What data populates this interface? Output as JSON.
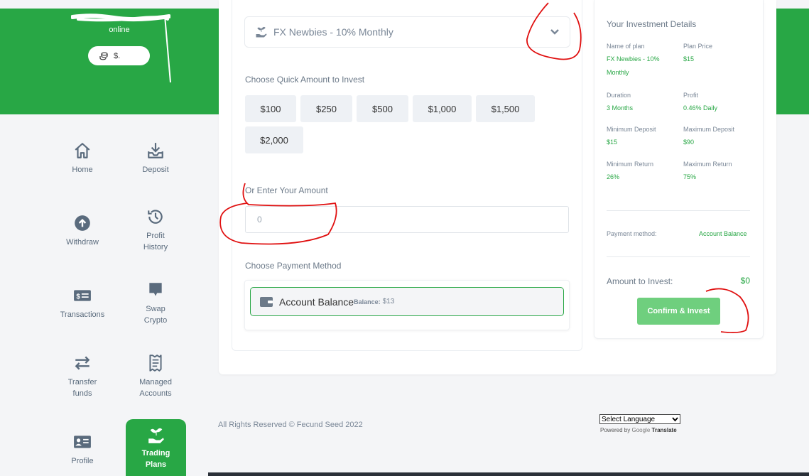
{
  "colors": {
    "brand_green": "#28a745",
    "confirm_green": "#6fcf7e",
    "annotation_red": "#e01010"
  },
  "sidebar": {
    "status": "online",
    "balance": "$.",
    "items": [
      {
        "label": "Home",
        "icon": "home-icon"
      },
      {
        "label": "Deposit",
        "icon": "download-icon"
      },
      {
        "label": "Withdraw",
        "icon": "arrow-up-circle-icon"
      },
      {
        "label": "Profit History",
        "icon": "history-icon"
      },
      {
        "label": "Transactions",
        "icon": "money-icon"
      },
      {
        "label": "Swap Crypto",
        "icon": "chat-icon"
      },
      {
        "label": "Transfer funds",
        "icon": "transfer-icon"
      },
      {
        "label": "Managed Accounts",
        "icon": "receipt-icon"
      },
      {
        "label": "Profile",
        "icon": "id-card-icon"
      },
      {
        "label": "Trading Plans",
        "icon": "plant-hand-icon"
      }
    ]
  },
  "form": {
    "selected_plan": "FX Newbies - 10% Monthly",
    "quick_amount_label": "Choose Quick Amount to Invest",
    "quick_amounts": [
      "$100",
      "$250",
      "$500",
      "$1,000",
      "$1,500",
      "$2,000"
    ],
    "enter_amount_label": "Or Enter Your Amount",
    "amount_value": "0",
    "payment_label": "Choose Payment Method",
    "payment_option": {
      "name": "Account Balance",
      "balance_label": "Balance:",
      "balance_value": "$13"
    }
  },
  "details": {
    "title": "Your Investment Details",
    "name_of_plan_label": "Name of plan",
    "name_of_plan_line1": "FX Newbies - 10%",
    "name_of_plan_line2": "Monthly",
    "plan_price_label": "Plan Price",
    "plan_price": "$15",
    "duration_label": "Duration",
    "duration": "3 Months",
    "profit_label": "Profit",
    "profit": "0.46% Daily",
    "min_deposit_label": "Minimum Deposit",
    "min_deposit": "$15",
    "max_deposit_label": "Maximum Deposit",
    "max_deposit": "$90",
    "min_return_label": "Minimum Return",
    "min_return": "26%",
    "max_return_label": "Maximum Return",
    "max_return": "75%",
    "payment_method_label": "Payment method:",
    "payment_method": "Account Balance",
    "amount_label": "Amount to Invest:",
    "amount": "$0",
    "confirm_label": "Confirm & Invest"
  },
  "footer": {
    "copyright": "All Rights Reserved © Fecund Seed 2022",
    "language_select": "Select Language",
    "powered_by": "Powered by",
    "google": "Google",
    "translate": "Translate"
  }
}
